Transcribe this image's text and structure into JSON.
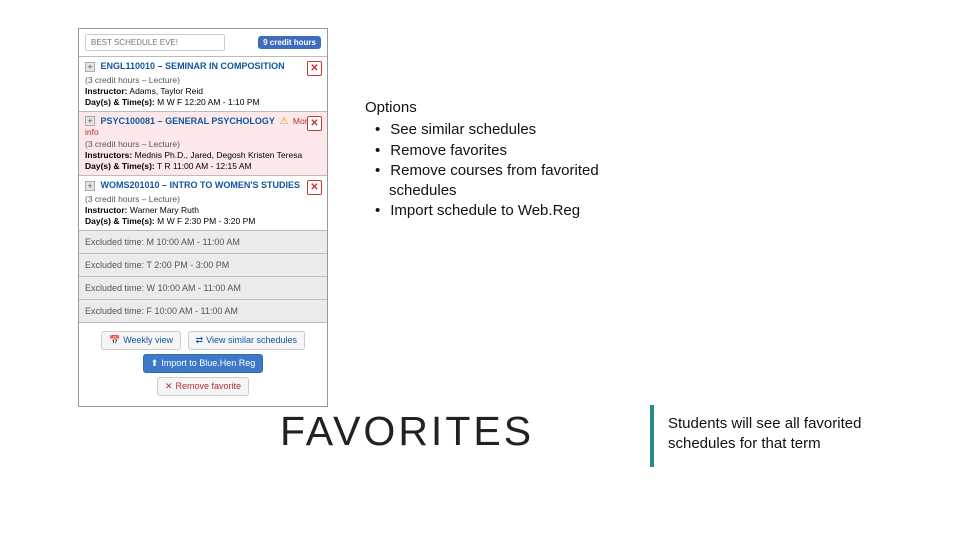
{
  "panel": {
    "schedule_name": "BEST SCHEDULE EVE!",
    "credit_badge": "9 credit hours",
    "courses": [
      {
        "title": "ENGL110010 – SEMINAR IN COMPOSITION",
        "sub": "(3 credit hours – Lecture)",
        "instr_label": "Instructor:",
        "instr": "Adams, Taylor Reid",
        "days_label": "Day(s) & Time(s):",
        "days": "M W F 12:20 AM - 1:10 PM",
        "pink": false,
        "warn": false,
        "moreinfo": ""
      },
      {
        "title": "PSYC100081 – GENERAL PSYCHOLOGY",
        "sub": "(3 credit hours – Lecture)",
        "instr_label": "Instructors:",
        "instr": "Mednis Ph.D., Jared, Degosh Kristen Teresa",
        "days_label": "Day(s) & Time(s):",
        "days": "T R 11:00 AM - 12:15 AM",
        "pink": true,
        "warn": true,
        "moreinfo": "More info"
      },
      {
        "title": "WOMS201010 – INTRO TO WOMEN'S STUDIES",
        "sub": "(3 credit hours – Lecture)",
        "instr_label": "Instructor:",
        "instr": "Warner Mary Ruth",
        "days_label": "Day(s) & Time(s):",
        "days": "M W F 2:30 PM - 3:20 PM",
        "pink": false,
        "warn": false,
        "moreinfo": ""
      }
    ],
    "excluded": [
      "Excluded time: M 10:00 AM - 11:00 AM",
      "Excluded time: T 2:00 PM - 3:00 PM",
      "Excluded time: W 10:00 AM - 11:00 AM",
      "Excluded time: F 10:00 AM - 11:00 AM"
    ],
    "footer": {
      "weekly": "Weekly view",
      "similar": "View similar schedules",
      "import": "Import to Blue.Hen Reg",
      "remove": "Remove favorite"
    }
  },
  "options": {
    "heading": "Options",
    "items": [
      "See similar schedules",
      "Remove favorites",
      "Remove courses from favorited schedules",
      "Import schedule to Web.Reg"
    ]
  },
  "big_title": "FAVORITES",
  "caption": "Students will see all favorited schedules for that term"
}
